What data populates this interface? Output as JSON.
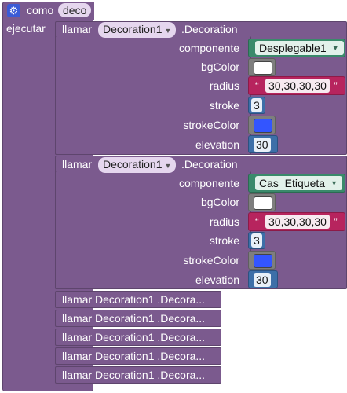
{
  "procedure": {
    "keyword": "como",
    "name": "deco",
    "do_label": "ejecutar",
    "gear_icon": "gear-icon"
  },
  "calls": [
    {
      "call_label": "llamar",
      "component": "Decoration1",
      "method": ".Decoration",
      "params": {
        "componente_label": "componente",
        "componente_value": "Desplegable1",
        "bgcolor_label": "bgColor",
        "bgcolor_value": "#ffffff",
        "radius_label": "radius",
        "radius_value": "30,30,30,30",
        "stroke_label": "stroke",
        "stroke_value": "3",
        "strokecolor_label": "strokeColor",
        "strokecolor_value": "#3355ff",
        "elevation_label": "elevation",
        "elevation_value": "30"
      }
    },
    {
      "call_label": "llamar",
      "component": "Decoration1",
      "method": ".Decoration",
      "params": {
        "componente_label": "componente",
        "componente_value": "Cas_Etiqueta",
        "bgcolor_label": "bgColor",
        "bgcolor_value": "#ffffff",
        "radius_label": "radius",
        "radius_value": "30,30,30,30",
        "stroke_label": "stroke",
        "stroke_value": "3",
        "strokecolor_label": "strokeColor",
        "strokecolor_value": "#3355ff",
        "elevation_label": "elevation",
        "elevation_value": "30"
      }
    }
  ],
  "collapsed_calls": [
    "llamar  Decoration1 .Decora...",
    "llamar  Decoration1 .Decora...",
    "llamar  Decoration1 .Decora...",
    "llamar  Decoration1 .Decora...",
    "llamar  Decoration1 .Decora..."
  ],
  "quote_open": "“",
  "quote_close": "”",
  "colors": {
    "procedure": "#7b5a8e",
    "component_block": "#3a8a6b",
    "color_block": "#7e7e7e",
    "text_block": "#b7245e",
    "number_block": "#3d6fa8"
  }
}
